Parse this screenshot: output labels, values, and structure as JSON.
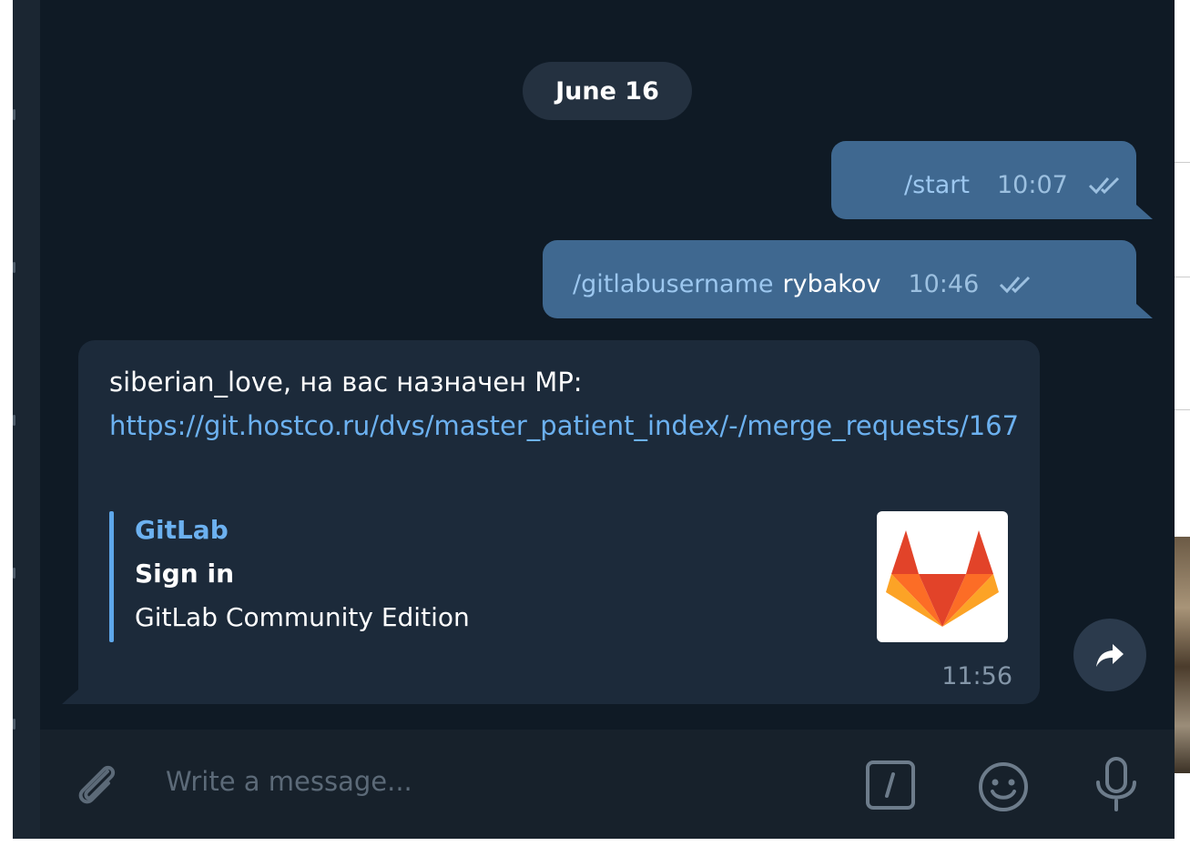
{
  "chat": {
    "date_separator": "June 16",
    "outgoing": [
      {
        "command": "/start",
        "argument": "",
        "time": "10:07",
        "status": "read"
      },
      {
        "command": "/gitlabusername",
        "argument": "rybakov",
        "time": "10:46",
        "status": "read"
      }
    ],
    "incoming": {
      "text": "siberian_love, на вас назначен MP:",
      "link": "https://git.hostco.ru/dvs/master_patient_index/-/merge_requests/167",
      "preview": {
        "site_name": "GitLab",
        "title": "Sign in",
        "description": "GitLab Community Edition",
        "thumbnail_icon": "gitlab-logo"
      },
      "time": "11:56"
    },
    "forward_icon": "forward-arrow-icon"
  },
  "composer": {
    "placeholder": "Write a message...",
    "attach_icon": "paperclip-icon",
    "commands_icon": "slash-command-icon",
    "emoji_icon": "emoji-icon",
    "mic_icon": "microphone-icon"
  },
  "colors": {
    "chat_bg": "#0f1a25",
    "outgoing_bubble": "#3f6890",
    "incoming_bubble": "#1c2a3a",
    "link": "#6cb1f0",
    "composer_bg": "#17212b"
  }
}
